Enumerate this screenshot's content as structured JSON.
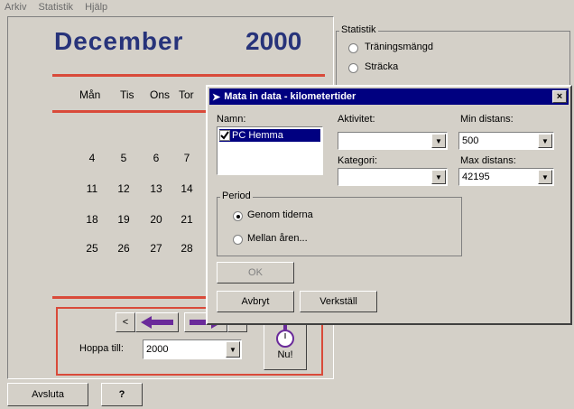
{
  "menu": [
    "Arkiv",
    "Statistik",
    "Hjälp"
  ],
  "calendar": {
    "month": "December",
    "year": "2000",
    "daynames": [
      "Mån",
      "Tis",
      "Ons",
      "Tor"
    ],
    "rows": [
      [
        "4",
        "5",
        "6",
        "7"
      ],
      [
        "11",
        "12",
        "13",
        "14"
      ],
      [
        "18",
        "19",
        "20",
        "21"
      ],
      [
        "25",
        "26",
        "27",
        "28"
      ]
    ]
  },
  "nav": {
    "prev_label": "<",
    "next_label": ">",
    "hoppa_label": "Hoppa till:",
    "year_value": "2000",
    "nu_label": "Nu!"
  },
  "statistik": {
    "legend": "Statistik",
    "options": [
      "Träningsmängd",
      "Sträcka"
    ]
  },
  "footer": {
    "avsluta": "Avsluta",
    "help": "?"
  },
  "dialog": {
    "title": "Mata in data - kilometertider",
    "close": "×",
    "namn_label": "Namn:",
    "namn_item": "PC Hemma",
    "aktivitet_label": "Aktivitet:",
    "aktivitet_value": "",
    "kategori_label": "Kategori:",
    "kategori_value": "",
    "min_label": "Min distans:",
    "min_value": "500",
    "max_label": "Max distans:",
    "max_value": "42195",
    "period_legend": "Period",
    "period_options": [
      "Genom tiderna",
      "Mellan åren..."
    ],
    "ok": "OK",
    "avbryt": "Avbryt",
    "verkstall": "Verkställ"
  },
  "colors": {
    "accent_red": "#d94a3a",
    "title_blue": "#27337a",
    "arrow_purple": "#6a2a9a",
    "titlebar": "#000080"
  }
}
